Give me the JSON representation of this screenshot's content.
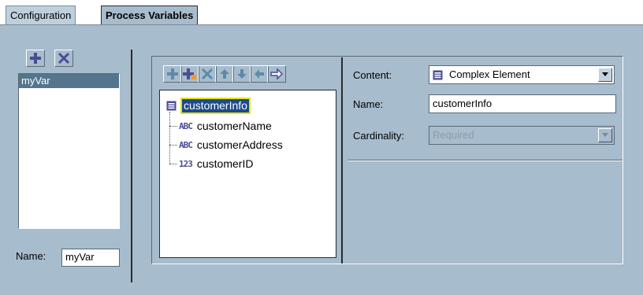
{
  "tabs": [
    {
      "label": "Configuration"
    },
    {
      "label": "Process Variables"
    }
  ],
  "variables": {
    "list": [
      "myVar"
    ],
    "name_label": "Name:",
    "name_value": "myVar"
  },
  "tree": {
    "root": {
      "label": "customerInfo",
      "icon": "complex-element-icon"
    },
    "children": [
      {
        "label": "customerName",
        "icon": "string-type-icon"
      },
      {
        "label": "customerAddress",
        "icon": "string-type-icon"
      },
      {
        "label": "customerID",
        "icon": "integer-type-icon"
      }
    ]
  },
  "properties": {
    "content_label": "Content:",
    "content_value": "Complex Element",
    "name_label": "Name:",
    "name_value": "customerInfo",
    "cardinality_label": "Cardinality:",
    "cardinality_value": "Required"
  },
  "colors": {
    "panel": "#a7bccd",
    "accent_icon": "#4b4d93",
    "selection": "#54758c",
    "tree_highlight": "#1d4a8c",
    "arrow_orange": "#f09a2a"
  }
}
